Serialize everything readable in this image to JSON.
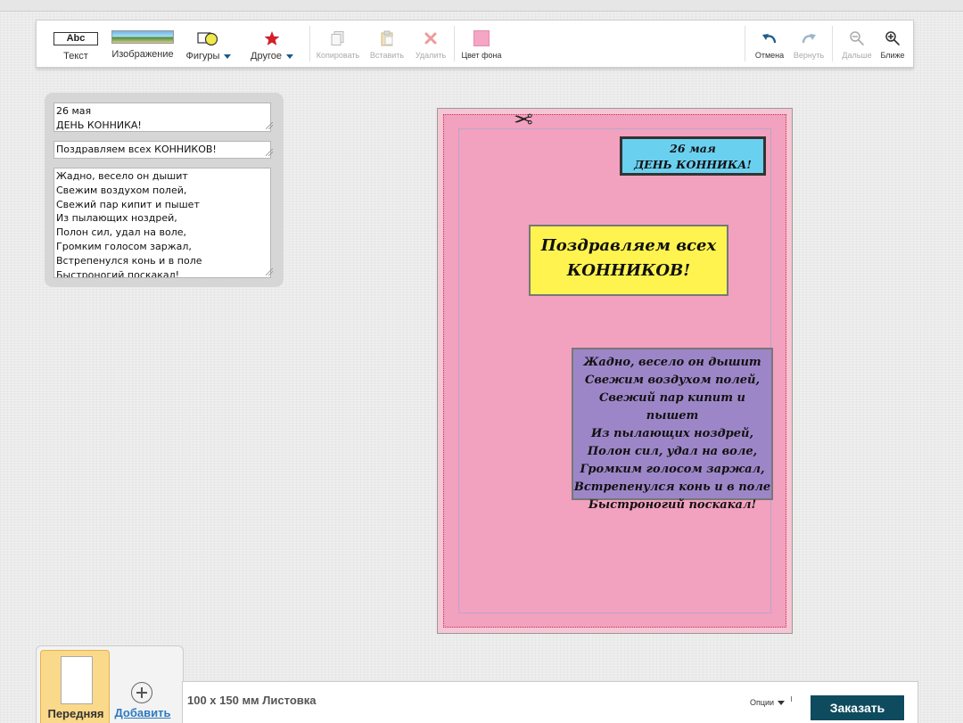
{
  "toolbar": {
    "text": {
      "label": "Текст",
      "icon": "abc-text-icon",
      "glyph": "Abc"
    },
    "image": {
      "label": "Изображение",
      "icon": "image-thumbnail-icon"
    },
    "shapes": {
      "label": "Фигуры",
      "icon": "shapes-icon"
    },
    "other": {
      "label": "Другое",
      "icon": "star-icon"
    },
    "copy": {
      "label": "Копировать",
      "icon": "copy-icon"
    },
    "paste": {
      "label": "Вставить",
      "icon": "paste-icon"
    },
    "delete": {
      "label": "Удалить",
      "icon": "delete-icon"
    },
    "background": {
      "label": "Цвет фона",
      "icon": "background-color-swatch",
      "color": "#f4a6c4"
    },
    "undo": {
      "label": "Отмена",
      "icon": "undo-icon"
    },
    "redo": {
      "label": "Вернуть",
      "icon": "redo-icon"
    },
    "zoom_out": {
      "label": "Дальше",
      "icon": "zoom-out-icon"
    },
    "zoom_in": {
      "label": "Ближе",
      "icon": "zoom-in-icon"
    }
  },
  "editor": {
    "field1": "26 мая\nДЕНЬ КОННИКА!",
    "field2": "Поздравляем всех КОННИКОВ!",
    "field3": "Жадно, весело он дышит\nСвежим воздухом полей,\nСвежий пар кипит и пышет\nИз пылающих ноздрей,\nПолон сил, удал на воле,\nГромким голосом заржал,\nВстрепенулся конь и в поле\nБыстроногий поскакал!"
  },
  "card": {
    "background_color": "#f2a1bf",
    "box1": {
      "line1": "26 мая",
      "line2": "ДЕНЬ КОННИКА!",
      "color": "#6ad0f0"
    },
    "box2": {
      "line1": "Поздравляем всех",
      "line2": "КОННИКОВ!",
      "color": "#fff44f"
    },
    "box3": {
      "color": "#9d86c8",
      "lines": [
        "Жадно, весело он дышит",
        "Свежим воздухом полей,",
        "Свежий пар кипит и пышет",
        "Из пылающих ноздрей,",
        "Полон сил, удал на воле,",
        "Громким голосом заржал,",
        "Встрепенулся конь и в поле",
        "Быстроногий поскакал!"
      ]
    }
  },
  "pages": {
    "front": "Передняя",
    "add": "Добавить"
  },
  "footer": {
    "size": "100 x 150 мм Листовка",
    "options": "Опции",
    "order": "Заказать"
  }
}
